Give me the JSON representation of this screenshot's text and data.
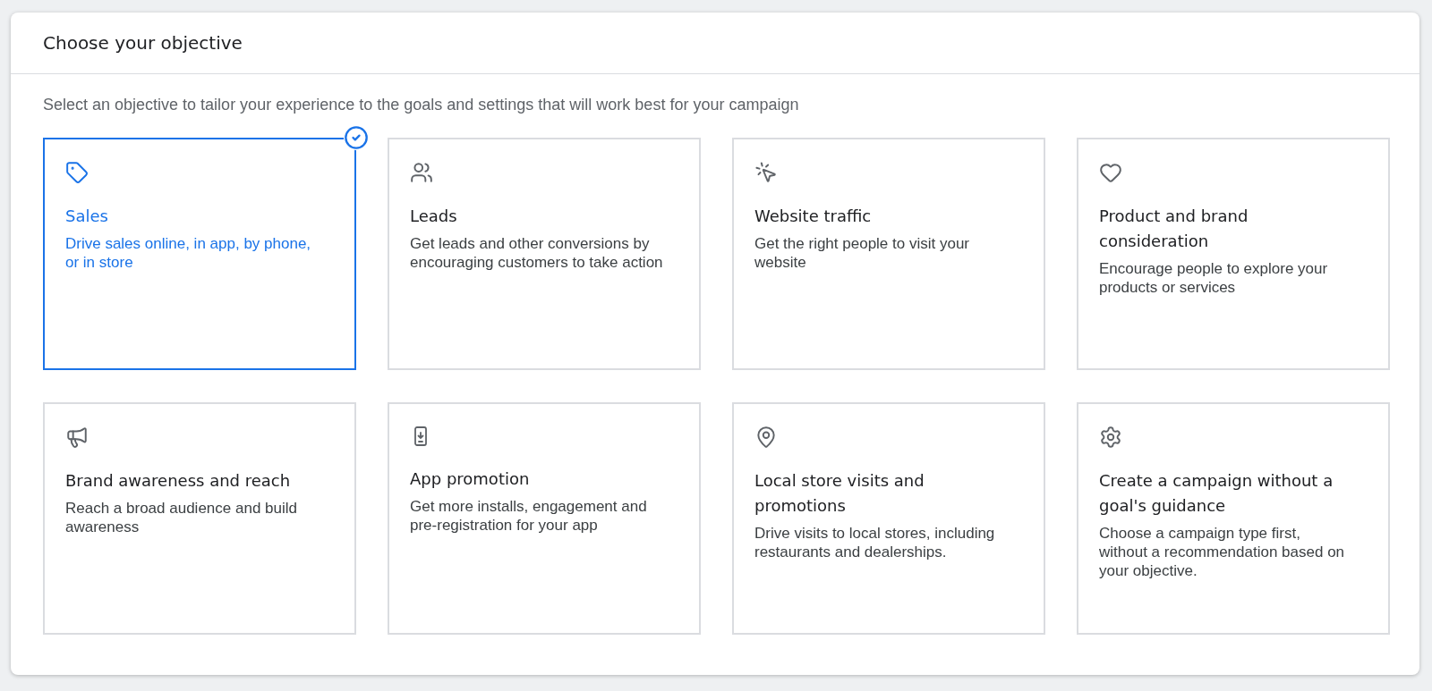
{
  "panel": {
    "title": "Choose your objective",
    "subtitle": "Select an objective to tailor your experience to the goals and settings that will work best for your campaign"
  },
  "objectives": [
    {
      "kind": "tag",
      "title": "Sales",
      "description": "Drive sales online, in app, by phone, or in store",
      "selected": true
    },
    {
      "kind": "people",
      "title": "Leads",
      "description": "Get leads and other conversions by encouraging customers to take action",
      "selected": false
    },
    {
      "kind": "click",
      "title": "Website traffic",
      "description": "Get the right people to visit your website",
      "selected": false
    },
    {
      "kind": "heart",
      "title": "Product and brand consideration",
      "description": "Encourage people to explore your products or services",
      "selected": false
    },
    {
      "kind": "megaphone",
      "title": "Brand awareness and reach",
      "description": "Reach a broad audience and build awareness",
      "selected": false
    },
    {
      "kind": "phone",
      "title": "App promotion",
      "description": "Get more installs, engagement and pre-registration for your app",
      "selected": false
    },
    {
      "kind": "pin",
      "title": "Local store visits and promotions",
      "description": "Drive visits to local stores, including restaurants and dealerships.",
      "selected": false
    },
    {
      "kind": "gear",
      "title": "Create a campaign without a goal's guidance",
      "description": "Choose a campaign type first, without a recommendation based on your objective.",
      "selected": false
    }
  ]
}
